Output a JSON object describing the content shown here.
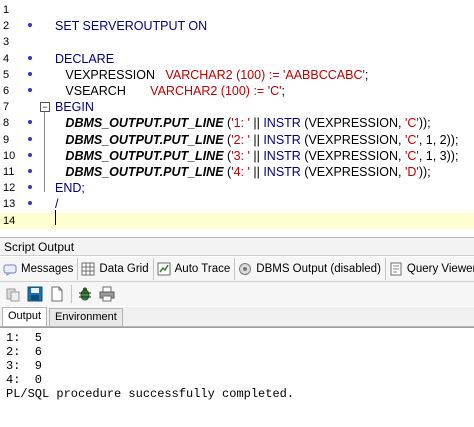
{
  "editor": {
    "lines": [
      {
        "num": "1",
        "bp": false
      },
      {
        "num": "2",
        "bp": true,
        "parts": [
          {
            "c": "kw",
            "t": "SET SERVEROUTPUT ON"
          }
        ]
      },
      {
        "num": "3",
        "bp": false
      },
      {
        "num": "4",
        "bp": true,
        "parts": [
          {
            "c": "kw",
            "t": "DECLARE"
          }
        ]
      },
      {
        "num": "5",
        "bp": true,
        "parts": [
          {
            "c": "plain",
            "t": "   VEXPRESSION   "
          },
          {
            "c": "type",
            "t": "VARCHAR2 (100) := "
          },
          {
            "c": "str",
            "t": "'AABBCCABC'"
          },
          {
            "c": "plain",
            "t": ";"
          }
        ]
      },
      {
        "num": "6",
        "bp": true,
        "parts": [
          {
            "c": "plain",
            "t": "   VSEARCH       "
          },
          {
            "c": "type",
            "t": "VARCHAR2 (100) := "
          },
          {
            "c": "str",
            "t": "'C'"
          },
          {
            "c": "plain",
            "t": ";"
          }
        ]
      },
      {
        "num": "7",
        "bp": false,
        "fold": "−",
        "parts": [
          {
            "c": "kw",
            "t": "BEGIN"
          }
        ]
      },
      {
        "num": "8",
        "bp": true,
        "parts": [
          {
            "c": "plain",
            "t": "   "
          },
          {
            "c": "proc",
            "t": "DBMS_OUTPUT.PUT_LINE"
          },
          {
            "c": "plain",
            "t": " ("
          },
          {
            "c": "str",
            "t": "'1: '"
          },
          {
            "c": "plain",
            "t": " || "
          },
          {
            "c": "kw",
            "t": "INSTR"
          },
          {
            "c": "plain",
            "t": " (VEXPRESSION, "
          },
          {
            "c": "str",
            "t": "'C'"
          },
          {
            "c": "plain",
            "t": "));"
          }
        ]
      },
      {
        "num": "9",
        "bp": true,
        "parts": [
          {
            "c": "plain",
            "t": "   "
          },
          {
            "c": "proc",
            "t": "DBMS_OUTPUT.PUT_LINE"
          },
          {
            "c": "plain",
            "t": " ("
          },
          {
            "c": "str",
            "t": "'2: '"
          },
          {
            "c": "plain",
            "t": " || "
          },
          {
            "c": "kw",
            "t": "INSTR"
          },
          {
            "c": "plain",
            "t": " (VEXPRESSION, "
          },
          {
            "c": "str",
            "t": "'C'"
          },
          {
            "c": "plain",
            "t": ", 1, 2));"
          }
        ]
      },
      {
        "num": "10",
        "bp": true,
        "parts": [
          {
            "c": "plain",
            "t": "   "
          },
          {
            "c": "proc",
            "t": "DBMS_OUTPUT.PUT_LINE"
          },
          {
            "c": "plain",
            "t": " ("
          },
          {
            "c": "str",
            "t": "'3: '"
          },
          {
            "c": "plain",
            "t": " || "
          },
          {
            "c": "kw",
            "t": "INSTR"
          },
          {
            "c": "plain",
            "t": " (VEXPRESSION, "
          },
          {
            "c": "str",
            "t": "'C'"
          },
          {
            "c": "plain",
            "t": ", 1, 3));"
          }
        ]
      },
      {
        "num": "11",
        "bp": true,
        "parts": [
          {
            "c": "plain",
            "t": "   "
          },
          {
            "c": "proc",
            "t": "DBMS_OUTPUT.PUT_LINE"
          },
          {
            "c": "plain",
            "t": " ("
          },
          {
            "c": "str",
            "t": "'4: '"
          },
          {
            "c": "plain",
            "t": " || "
          },
          {
            "c": "kw",
            "t": "INSTR"
          },
          {
            "c": "plain",
            "t": " (VEXPRESSION, "
          },
          {
            "c": "str",
            "t": "'D'"
          },
          {
            "c": "plain",
            "t": "));"
          }
        ]
      },
      {
        "num": "12",
        "bp": true,
        "parts": [
          {
            "c": "kw",
            "t": "END;"
          }
        ]
      },
      {
        "num": "13",
        "bp": true,
        "parts": [
          {
            "c": "kw",
            "t": "/"
          }
        ]
      },
      {
        "num": "14",
        "bp": false,
        "current": true
      }
    ]
  },
  "output_panel": {
    "title": "Script Output",
    "tabs": [
      {
        "label": "Messages",
        "icon": "messages-icon"
      },
      {
        "label": "Data Grid",
        "icon": "data-grid-icon"
      },
      {
        "label": "Auto Trace",
        "icon": "auto-trace-icon"
      },
      {
        "label": "DBMS Output (disabled)",
        "icon": "dbms-output-icon"
      },
      {
        "label": "Query Viewer",
        "icon": "query-viewer-icon"
      }
    ],
    "inner_tabs": [
      "Output",
      "Environment"
    ],
    "output_lines": [
      "1:  5",
      "2:  6",
      "3:  9",
      "4:  0",
      "PL/SQL procedure successfully completed."
    ]
  },
  "colors": {
    "keyword": "#000080",
    "string": "#c00000",
    "current_line": "#ffffd2",
    "breakpoint": "#2f35c8"
  }
}
